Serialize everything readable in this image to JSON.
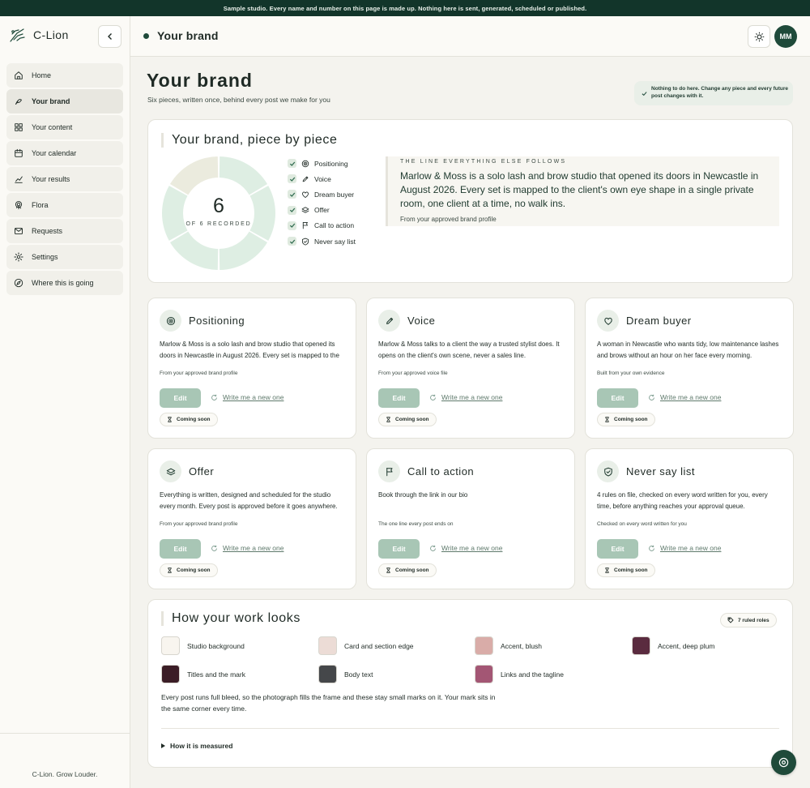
{
  "banner": "Sample studio. Every name and number on this page is made up. Nothing here is sent, generated, scheduled or published.",
  "app": {
    "name": "C-Lion",
    "tagline": "C-Lion. Grow Louder."
  },
  "sidebar": {
    "items": [
      {
        "label": "Home",
        "icon": "home-icon"
      },
      {
        "label": "Your brand",
        "icon": "brand-icon",
        "active": true
      },
      {
        "label": "Your content",
        "icon": "grid-icon"
      },
      {
        "label": "Your calendar",
        "icon": "calendar-icon"
      },
      {
        "label": "Your results",
        "icon": "chart-icon"
      },
      {
        "label": "Flora",
        "icon": "flora-icon"
      },
      {
        "label": "Requests",
        "icon": "mail-icon"
      },
      {
        "label": "Settings",
        "icon": "settings-icon"
      },
      {
        "label": "Where this is going",
        "icon": "compass-icon"
      }
    ]
  },
  "topbar": {
    "title": "Your brand",
    "avatar": "MM"
  },
  "page": {
    "title": "Your brand",
    "subtitle": "Six pieces, written once, behind every post we make for you",
    "notice": "Nothing to do here. Change any piece and every future post changes with it."
  },
  "overview": {
    "heading": "Your brand, piece by piece",
    "count": "6",
    "count_label": "OF 6 RECORDED",
    "recorded": 6,
    "total": 6,
    "checklist": [
      "Positioning",
      "Voice",
      "Dream buyer",
      "Offer",
      "Call to action",
      "Never say list"
    ],
    "quote_kicker": "THE LINE EVERYTHING ELSE FOLLOWS",
    "quote": "Marlow & Moss is a solo lash and brow studio that opened its doors in Newcastle in August 2026. Every set is mapped to the client's own eye shape in a single private room, one client at a time, no walk ins.",
    "quote_source": "From your approved brand profile"
  },
  "pieces": [
    {
      "name": "Positioning",
      "icon": "target-icon",
      "body": "Marlow & Moss is a solo lash and brow studio that opened its doors in Newcastle in August 2026. Every set is mapped to the client's own eye shape.",
      "source": "From your approved brand profile"
    },
    {
      "name": "Voice",
      "icon": "pen-icon",
      "body": "Marlow & Moss talks to a client the way a trusted stylist does. It opens on the client's own scene, never a sales line.",
      "source": "From your approved voice file"
    },
    {
      "name": "Dream buyer",
      "icon": "heart-icon",
      "body": "A woman in Newcastle who wants tidy, low maintenance lashes and brows without an hour on her face every morning.",
      "source": "Built from your own evidence"
    },
    {
      "name": "Offer",
      "icon": "layers-icon",
      "body": "Everything is written, designed and scheduled for the studio every month. Every post is approved before it goes anywhere.",
      "source": "From your approved brand profile"
    },
    {
      "name": "Call to action",
      "icon": "flag-icon",
      "body": "Book through the link in our bio",
      "source": "The one line every post ends on"
    },
    {
      "name": "Never say list",
      "icon": "shield-icon",
      "body": "4 rules on file, checked on every word written for you, every time, before anything reaches your approval queue.",
      "source": "Checked on every word written for you"
    }
  ],
  "actions": {
    "edit": "Edit",
    "write": "Write me a new one",
    "soon": "Coming soon"
  },
  "looks": {
    "heading": "How your work looks",
    "badge": "7 ruled roles",
    "swatches": [
      {
        "label": "Studio background",
        "color": "#f8f5ef"
      },
      {
        "label": "Card and section edge",
        "color": "#ecdcd6"
      },
      {
        "label": "Accent, blush",
        "color": "#d9aca8"
      },
      {
        "label": "Accent, deep plum",
        "color": "#5a2b3f"
      },
      {
        "label": "Titles and the mark",
        "color": "#3b1d26"
      },
      {
        "label": "Body text",
        "color": "#45474a"
      },
      {
        "label": "Links and the tagline",
        "color": "#a35674"
      }
    ],
    "note": "Every post runs full bleed, so the photograph fills the frame and these stay small marks on it. Your mark sits in the same corner every time.",
    "measured": "How it is measured"
  }
}
